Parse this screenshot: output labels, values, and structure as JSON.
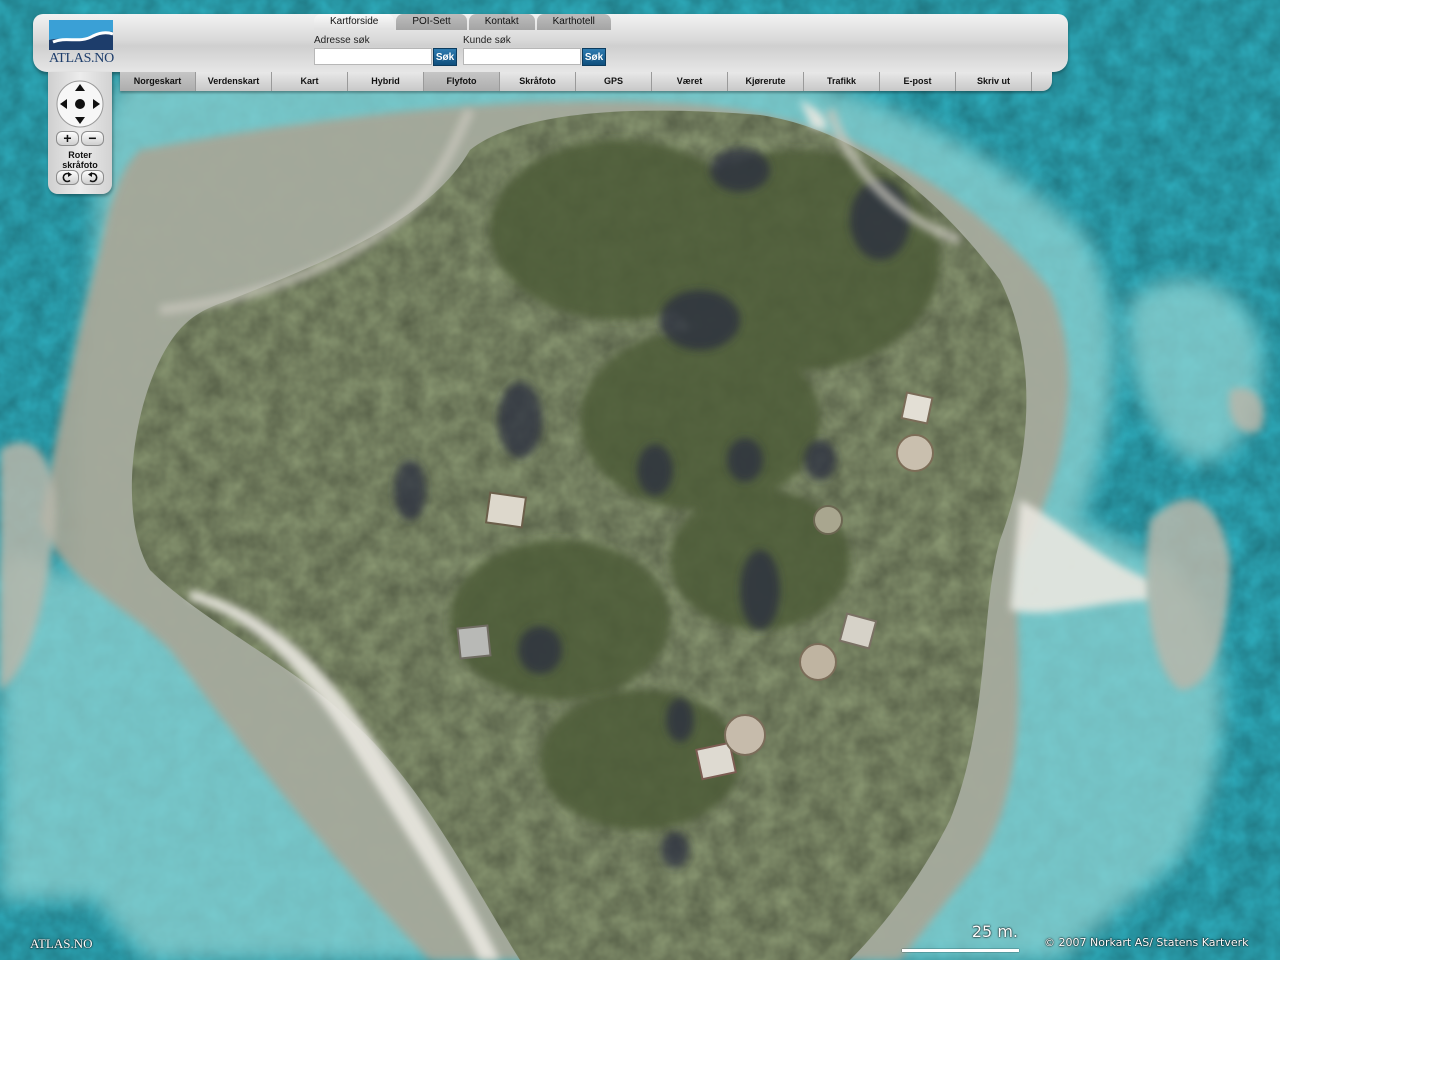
{
  "brand": {
    "wordmark": "ATLAS.NO",
    "colors": {
      "navy": "#1d3d6b",
      "sky": "#3aa0d6"
    }
  },
  "tabs": [
    {
      "label": "Kartforside",
      "active": true
    },
    {
      "label": "POI-Sett",
      "active": false
    },
    {
      "label": "Kontakt",
      "active": false
    },
    {
      "label": "Karthotell",
      "active": false
    }
  ],
  "search": {
    "address": {
      "label": "Adresse søk",
      "value": "",
      "button": "Søk"
    },
    "customer": {
      "label": "Kunde søk",
      "value": "",
      "button": "Søk"
    }
  },
  "map_types": [
    {
      "label": "Norgeskart",
      "selected": true
    },
    {
      "label": "Verdenskart",
      "selected": false
    },
    {
      "label": "Kart",
      "selected": false
    },
    {
      "label": "Hybrid",
      "selected": false
    },
    {
      "label": "Flyfoto",
      "selected": true
    },
    {
      "label": "Skråfoto",
      "selected": false
    },
    {
      "label": "GPS",
      "selected": false
    },
    {
      "label": "Været",
      "selected": false
    },
    {
      "label": "Kjørerute",
      "selected": false
    },
    {
      "label": "Trafikk",
      "selected": false
    },
    {
      "label": "E-post",
      "selected": false
    },
    {
      "label": "Skriv ut",
      "selected": false
    }
  ],
  "nav": {
    "zoom_in": "+",
    "zoom_out": "−",
    "rotate_label_line1": "Roter",
    "rotate_label_line2": "skråfoto",
    "icons": [
      "pan-up-icon",
      "pan-down-icon",
      "pan-left-icon",
      "pan-right-icon",
      "center-icon",
      "rotate-left-icon",
      "rotate-right-icon"
    ]
  },
  "map": {
    "mode": "aerial photo",
    "watermark": "ATLAS.NO",
    "scale_label": "25 m.",
    "copyright": "© 2007 Norkart AS/ Statens Kartverk",
    "colors": {
      "water": "#35b7c4",
      "shallow": "#8fd5d6",
      "land": "#8d9873",
      "vegetation": "#4d5a3a",
      "beach": "#e8e6df"
    }
  }
}
